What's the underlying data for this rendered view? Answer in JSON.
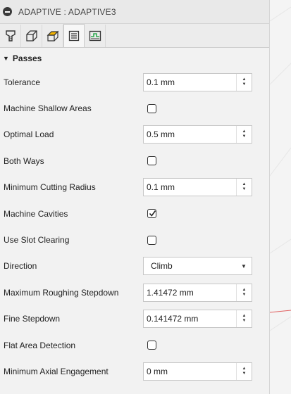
{
  "window": {
    "title": "ADAPTIVE : ADAPTIVE3"
  },
  "tabs": [
    {
      "icon": "tool-icon",
      "active": false
    },
    {
      "icon": "geometry-icon",
      "active": false
    },
    {
      "icon": "heights-icon",
      "active": false
    },
    {
      "icon": "passes-icon",
      "active": true
    },
    {
      "icon": "linking-icon",
      "active": false
    }
  ],
  "section": {
    "label": "Passes"
  },
  "params": {
    "tolerance": {
      "label": "Tolerance",
      "value": "0.1 mm"
    },
    "machine_shallow": {
      "label": "Machine Shallow Areas",
      "checked": false
    },
    "optimal_load": {
      "label": "Optimal Load",
      "value": "0.5 mm"
    },
    "both_ways": {
      "label": "Both Ways",
      "checked": false
    },
    "min_cutting_radius": {
      "label": "Minimum Cutting Radius",
      "value": "0.1 mm"
    },
    "machine_cavities": {
      "label": "Machine Cavities",
      "checked": true
    },
    "use_slot_clearing": {
      "label": "Use Slot Clearing",
      "checked": false
    },
    "direction": {
      "label": "Direction",
      "value": "Climb"
    },
    "max_rough_stepdown": {
      "label": "Maximum Roughing Stepdown",
      "value": "1.41472 mm"
    },
    "fine_stepdown": {
      "label": "Fine Stepdown",
      "value": "0.141472 mm"
    },
    "flat_area_detection": {
      "label": "Flat Area Detection",
      "checked": false
    },
    "min_axial_engagement": {
      "label": "Minimum Axial Engagement",
      "value": "0 mm"
    }
  },
  "colors": {
    "accent": "#f5b400",
    "line_red": "#e06060"
  }
}
